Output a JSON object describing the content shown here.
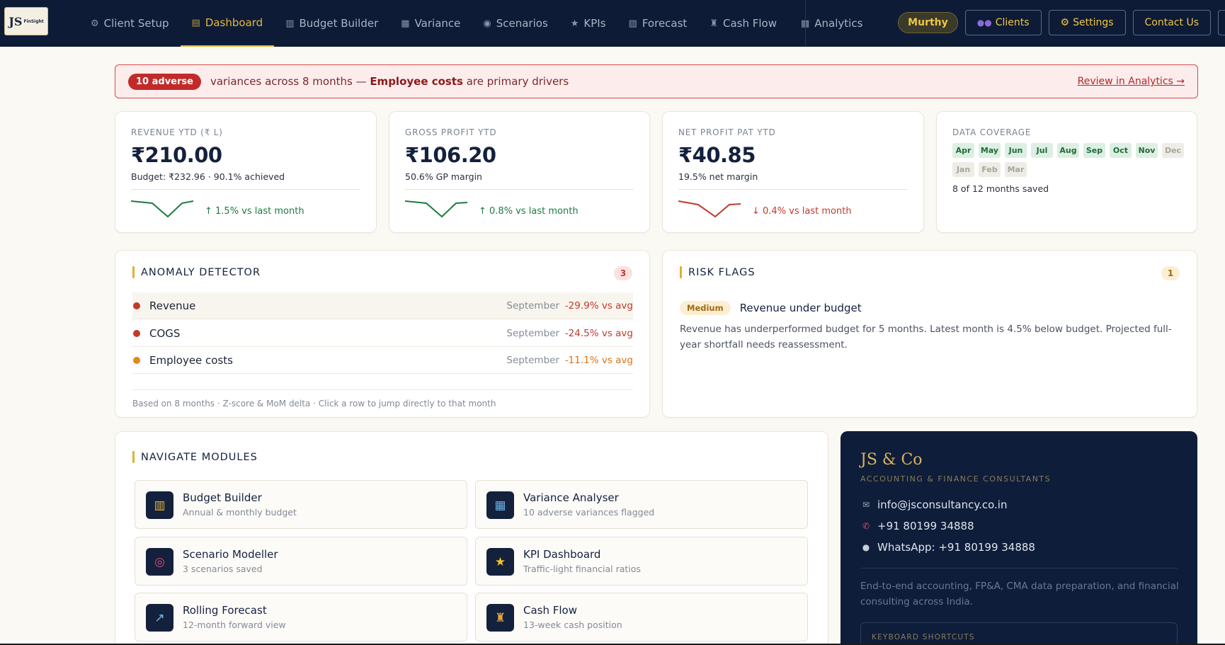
{
  "nav": {
    "logo_text": "JS",
    "logo_sub": "FinSight",
    "tabs": [
      {
        "label": "Client Setup",
        "icon": "⚙"
      },
      {
        "label": "Dashboard",
        "icon": "▤"
      },
      {
        "label": "Budget Builder",
        "icon": "▥"
      },
      {
        "label": "Variance",
        "icon": "▦"
      },
      {
        "label": "Scenarios",
        "icon": "◉"
      },
      {
        "label": "KPIs",
        "icon": "★"
      },
      {
        "label": "Forecast",
        "icon": "▨"
      },
      {
        "label": "Cash Flow",
        "icon": "♜"
      },
      {
        "label": "Analytics",
        "icon": "▩"
      }
    ],
    "active_tab": "Dashboard",
    "user": "Murthy",
    "clients_label": "Clients",
    "settings_label": "Settings",
    "contact_label": "Contact Us"
  },
  "alert": {
    "badge": "10 adverse",
    "text_before": "variances across 8 months — ",
    "text_bold": "Employee costs",
    "text_after": " are primary drivers",
    "link": "Review in Analytics →"
  },
  "kpis": [
    {
      "label": "REVENUE YTD (₹ L)",
      "value": "₹210.00",
      "sub": "Budget: ₹232.96 · 90.1% achieved",
      "delta": "↑ 1.5% vs last month",
      "trend": "up"
    },
    {
      "label": "GROSS PROFIT YTD",
      "value": "₹106.20",
      "sub": "50.6% GP margin",
      "delta": "↑ 0.8% vs last month",
      "trend": "up"
    },
    {
      "label": "NET PROFIT PAT YTD",
      "value": "₹40.85",
      "sub": "19.5% net margin",
      "delta": "↓ 0.4% vs last month",
      "trend": "down"
    }
  ],
  "coverage": {
    "label": "DATA COVERAGE",
    "months": [
      {
        "m": "Apr",
        "saved": true
      },
      {
        "m": "May",
        "saved": true
      },
      {
        "m": "Jun",
        "saved": true
      },
      {
        "m": "Jul",
        "saved": true
      },
      {
        "m": "Aug",
        "saved": true
      },
      {
        "m": "Sep",
        "saved": true
      },
      {
        "m": "Oct",
        "saved": true
      },
      {
        "m": "Nov",
        "saved": true
      },
      {
        "m": "Dec",
        "saved": false
      },
      {
        "m": "Jan",
        "saved": false
      },
      {
        "m": "Feb",
        "saved": false
      },
      {
        "m": "Mar",
        "saved": false
      }
    ],
    "summary": "8 of 12 months saved"
  },
  "anomaly": {
    "title": "ANOMALY DETECTOR",
    "count": "3",
    "rows": [
      {
        "name": "Revenue",
        "month": "September",
        "pct": "-29.9% vs avg",
        "severity": "#c23a2a"
      },
      {
        "name": "COGS",
        "month": "September",
        "pct": "-24.5% vs avg",
        "severity": "#c23a2a"
      },
      {
        "name": "Employee costs",
        "month": "September",
        "pct": "-11.1% vs avg",
        "severity": "#e08a1a"
      }
    ],
    "footer": "Based on 8 months · Z-score & MoM delta · Click a row to jump directly to that month"
  },
  "risk": {
    "title": "RISK FLAGS",
    "count": "1",
    "items": [
      {
        "severity": "Medium",
        "title": "Revenue under budget",
        "desc": "Revenue has underperformed budget for 5 months. Latest month is 4.5% below budget. Projected full-year shortfall needs reassessment."
      }
    ]
  },
  "modules": {
    "title": "NAVIGATE MODULES",
    "items": [
      {
        "title": "Budget Builder",
        "sub": "Annual & monthly budget",
        "icon": "▥"
      },
      {
        "title": "Variance Analyser",
        "sub": "10 adverse variances flagged",
        "icon": "▦"
      },
      {
        "title": "Scenario Modeller",
        "sub": "3 scenarios saved",
        "icon": "◎"
      },
      {
        "title": "KPI Dashboard",
        "sub": "Traffic-light financial ratios",
        "icon": "★"
      },
      {
        "title": "Rolling Forecast",
        "sub": "12-month forward view",
        "icon": "↗"
      },
      {
        "title": "Cash Flow",
        "sub": "13-week cash position",
        "icon": "♜"
      }
    ]
  },
  "company": {
    "name": "JS & Co",
    "tagline": "ACCOUNTING & FINANCE CONSULTANTS",
    "email": "info@jsconsultancy.co.in",
    "phone": "+91 80199 34888",
    "whatsapp": "WhatsApp: +91 80199 34888",
    "description": "End-to-end accounting, FP&A, CMA data preparation, and financial consulting across India.",
    "shortcuts_label": "KEYBOARD SHORTCUTS"
  },
  "colors": {
    "navy": "#0d1b36",
    "gold": "#e5b73b",
    "red": "#c23a2a",
    "green": "#1e7b40"
  }
}
